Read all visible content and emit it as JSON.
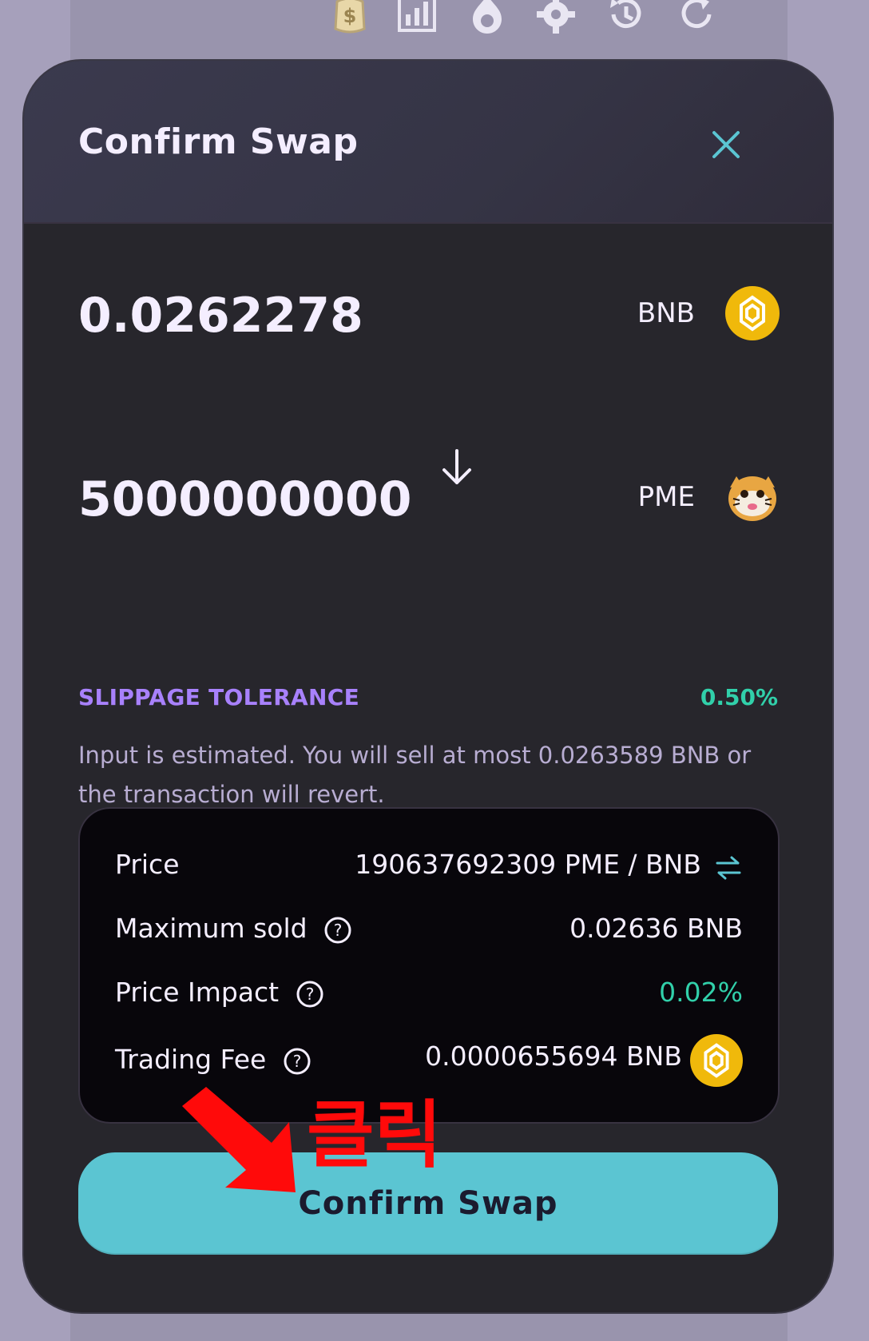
{
  "toolbar": {
    "icons": [
      "dollar-coin-icon",
      "bar-chart-icon",
      "flame-icon",
      "gear-icon",
      "history-icon",
      "refresh-icon"
    ]
  },
  "modal": {
    "title": "Confirm Swap",
    "close_icon": "close-icon"
  },
  "swap": {
    "input_amount": "0.0262278",
    "input_symbol": "BNB",
    "output_amount": "5000000000",
    "output_symbol": "PME"
  },
  "slippage": {
    "label": "SLIPPAGE TOLERANCE",
    "value": "0.50%"
  },
  "estimate_text": "Input is estimated. You will sell at most 0.0263589 BNB or the transaction will revert.",
  "details": {
    "price_label": "Price",
    "price_value": "190637692309 PME / BNB",
    "max_sold_label": "Maximum sold",
    "max_sold_value": "0.02636 BNB",
    "impact_label": "Price Impact",
    "impact_value": "0.02%",
    "fee_label": "Trading Fee",
    "fee_value": "0.0000655694 BNB"
  },
  "confirm_button": "Confirm Swap",
  "annotation": {
    "text": "클릭",
    "color": "#ff0a0a"
  },
  "colors": {
    "accent": "#5bc5d2",
    "purple": "#a881fc",
    "success": "#31d0aa",
    "bnb_gold": "#f0b90b"
  }
}
